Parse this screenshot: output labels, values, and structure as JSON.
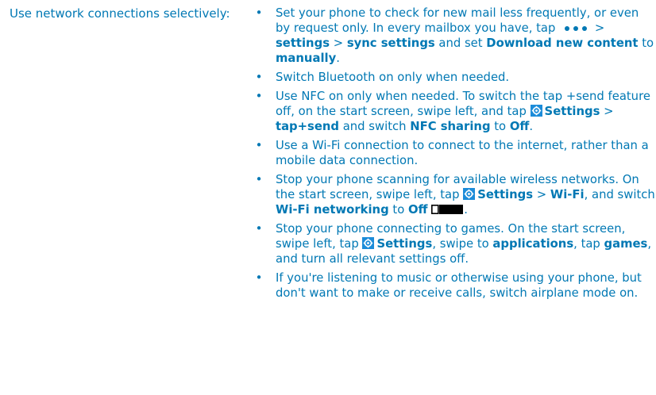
{
  "side_heading": "Use network connections selectively:",
  "tips": [
    {
      "p1": "Set your phone to check for new mail less frequently, or even by request only. In every mailbox you have, tap",
      "p2": " > ",
      "b1": "settings",
      "p3": " > ",
      "b2": "sync settings",
      "p4": " and set ",
      "b3": "Download new content",
      "p5": " to ",
      "b4": "manually",
      "p6": "."
    },
    {
      "text": "Switch Bluetooth on only when needed."
    },
    {
      "p1": "Use NFC on only when needed. To switch the tap +send feature off, on the start screen, swipe left, and tap ",
      "b1": "Settings",
      "p2": " > ",
      "b2": "tap+send",
      "p3": " and switch ",
      "b3": "NFC sharing",
      "p4": " to ",
      "b4": "Off",
      "p5": "."
    },
    {
      "text": "Use a Wi-Fi connection to connect to the internet, rather than a mobile data connection."
    },
    {
      "p1": "Stop your phone scanning for available wireless networks. On the start screen, swipe left, tap ",
      "b1": "Settings",
      "p2": " > ",
      "b2": "Wi-Fi",
      "p3": ", and switch ",
      "b3": "Wi-Fi networking",
      "p4": " to ",
      "b4": "Off",
      "p5": "."
    },
    {
      "p1": "Stop your phone connecting to games. On the start screen, swipe left, tap ",
      "b1": "Settings",
      "p2": ", swipe to ",
      "b2": "applications",
      "p3": ", tap ",
      "b3": "games",
      "p4": ", and turn all relevant settings off."
    },
    {
      "text": "If you're listening to music or otherwise using your phone, but don't want to make or receive calls, switch airplane mode on."
    }
  ],
  "bullet_symbol": "•",
  "icons": {
    "more": "ellipsis-icon",
    "settings": "settings-icon",
    "toggle": "toggle-off-icon"
  },
  "colors": {
    "text": "#0078b4",
    "icon": "#1c8cd9"
  }
}
